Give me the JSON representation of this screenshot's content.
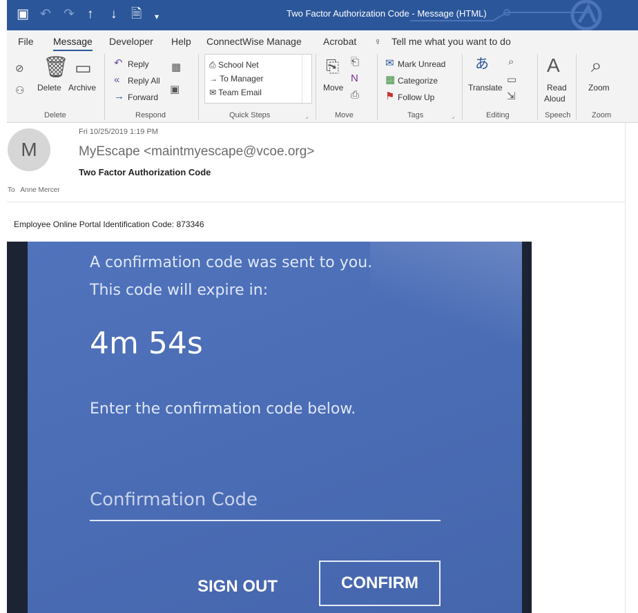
{
  "window": {
    "title": "Two Factor Authorization Code  -  Message (HTML)"
  },
  "ribbon_tabs": [
    "File",
    "Message",
    "Developer",
    "Help",
    "ConnectWise Manage",
    "Acrobat"
  ],
  "tell_me": "Tell me what you want to do",
  "ribbon": {
    "delete": {
      "delete_label": "Delete",
      "archive_label": "Archive",
      "group": "Delete"
    },
    "respond": {
      "reply": "Reply",
      "reply_all": "Reply All",
      "forward": "Forward",
      "group": "Respond"
    },
    "quick_steps": {
      "items": [
        "School Net",
        "To Manager",
        "Team Email"
      ],
      "group": "Quick Steps"
    },
    "move": {
      "move_label": "Move",
      "group": "Move"
    },
    "tags": {
      "mark_unread": "Mark Unread",
      "categorize": "Categorize",
      "follow_up": "Follow Up",
      "group": "Tags"
    },
    "editing": {
      "translate": "Translate",
      "group": "Editing"
    },
    "speech": {
      "read": "Read",
      "aloud": "Aloud",
      "group": "Speech"
    },
    "zoom": {
      "zoom_label": "Zoom",
      "group": "Zoom"
    }
  },
  "message": {
    "avatar_initial": "M",
    "date": "Fri 10/25/2019 1:19 PM",
    "sender": "MyEscape <maintmyescape@vcoe.org>",
    "subject": "Two Factor Authorization Code",
    "to_label": "To",
    "to_name": "Anne Mercer",
    "body_text": "Employee Online Portal Identification Code: 873346"
  },
  "embedded": {
    "line1": "A confirmation code was sent to you.",
    "line2": "This code will expire in:",
    "timer": "4m 54s",
    "instruction": "Enter the confirmation code below.",
    "input_placeholder": "Confirmation Code",
    "sign_out": "SIGN OUT",
    "confirm": "CONFIRM"
  },
  "colors": {
    "titlebar": "#2b579a",
    "ribbon_bg": "#f3f3f3",
    "embed_blue": "#4a6cb4"
  }
}
